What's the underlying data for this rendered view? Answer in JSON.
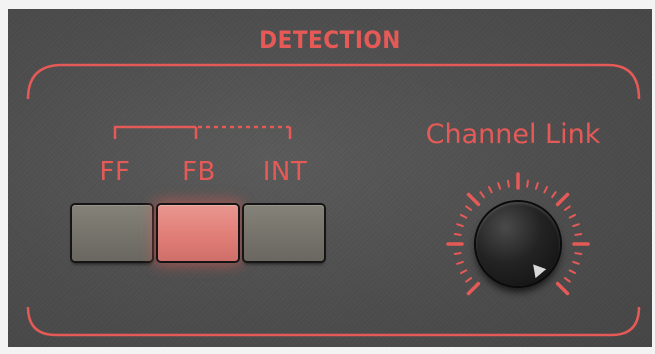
{
  "detection": {
    "title": "DETECTION",
    "modes": [
      {
        "label": "FF",
        "active": false
      },
      {
        "label": "FB",
        "active": true
      },
      {
        "label": "INT",
        "active": false
      }
    ],
    "channel_link": {
      "label": "Channel Link"
    }
  },
  "colors": {
    "accent": "#e55a57",
    "panel": "#4f4f4f",
    "button_active": "#e07e77",
    "button_inactive": "#77746c"
  }
}
